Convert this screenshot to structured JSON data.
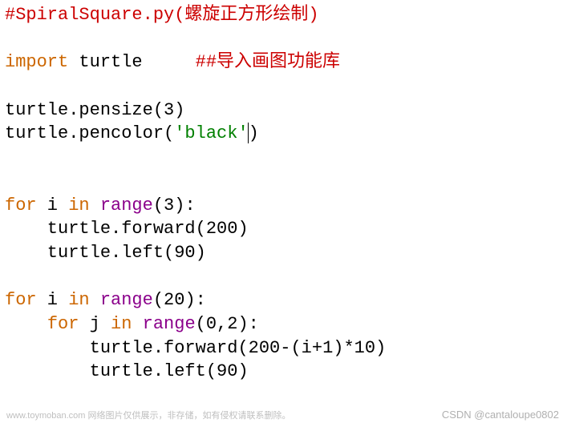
{
  "lines": [
    {
      "tokens": [
        {
          "cls": "tok-comment",
          "text": "#SpiralSquare.py(螺旋正方形绘制)"
        }
      ]
    },
    {
      "tokens": []
    },
    {
      "tokens": [
        {
          "cls": "tok-keyword",
          "text": "import"
        },
        {
          "cls": "tok-default",
          "text": " turtle     "
        },
        {
          "cls": "tok-comment",
          "text": "##导入画图功能库"
        }
      ]
    },
    {
      "tokens": []
    },
    {
      "tokens": [
        {
          "cls": "tok-default",
          "text": "turtle.pensize(3)"
        }
      ]
    },
    {
      "tokens": [
        {
          "cls": "tok-default",
          "text": "turtle.pencolor("
        },
        {
          "cls": "tok-string",
          "text": "'black'"
        },
        {
          "cls": "tok-default",
          "text": ")"
        }
      ],
      "cursorAfterToken": 1
    },
    {
      "tokens": []
    },
    {
      "tokens": []
    },
    {
      "tokens": [
        {
          "cls": "tok-keyword",
          "text": "for"
        },
        {
          "cls": "tok-default",
          "text": " i "
        },
        {
          "cls": "tok-keyword",
          "text": "in"
        },
        {
          "cls": "tok-default",
          "text": " "
        },
        {
          "cls": "tok-builtin",
          "text": "range"
        },
        {
          "cls": "tok-default",
          "text": "(3):"
        }
      ]
    },
    {
      "tokens": [
        {
          "cls": "tok-default",
          "text": "    turtle.forward(200)"
        }
      ]
    },
    {
      "tokens": [
        {
          "cls": "tok-default",
          "text": "    turtle.left(90)"
        }
      ]
    },
    {
      "tokens": []
    },
    {
      "tokens": [
        {
          "cls": "tok-keyword",
          "text": "for"
        },
        {
          "cls": "tok-default",
          "text": " i "
        },
        {
          "cls": "tok-keyword",
          "text": "in"
        },
        {
          "cls": "tok-default",
          "text": " "
        },
        {
          "cls": "tok-builtin",
          "text": "range"
        },
        {
          "cls": "tok-default",
          "text": "(20):"
        }
      ]
    },
    {
      "tokens": [
        {
          "cls": "tok-default",
          "text": "    "
        },
        {
          "cls": "tok-keyword",
          "text": "for"
        },
        {
          "cls": "tok-default",
          "text": " j "
        },
        {
          "cls": "tok-keyword",
          "text": "in"
        },
        {
          "cls": "tok-default",
          "text": " "
        },
        {
          "cls": "tok-builtin",
          "text": "range"
        },
        {
          "cls": "tok-default",
          "text": "(0,2):"
        }
      ]
    },
    {
      "tokens": [
        {
          "cls": "tok-default",
          "text": "        turtle.forward(200-(i+1)*10)"
        }
      ]
    },
    {
      "tokens": [
        {
          "cls": "tok-default",
          "text": "        turtle.left(90)"
        }
      ]
    }
  ],
  "watermark_left": "www.toymoban.com 网络图片仅供展示，非存储，如有侵权请联系删除。",
  "watermark_right": "CSDN @cantaloupe0802"
}
